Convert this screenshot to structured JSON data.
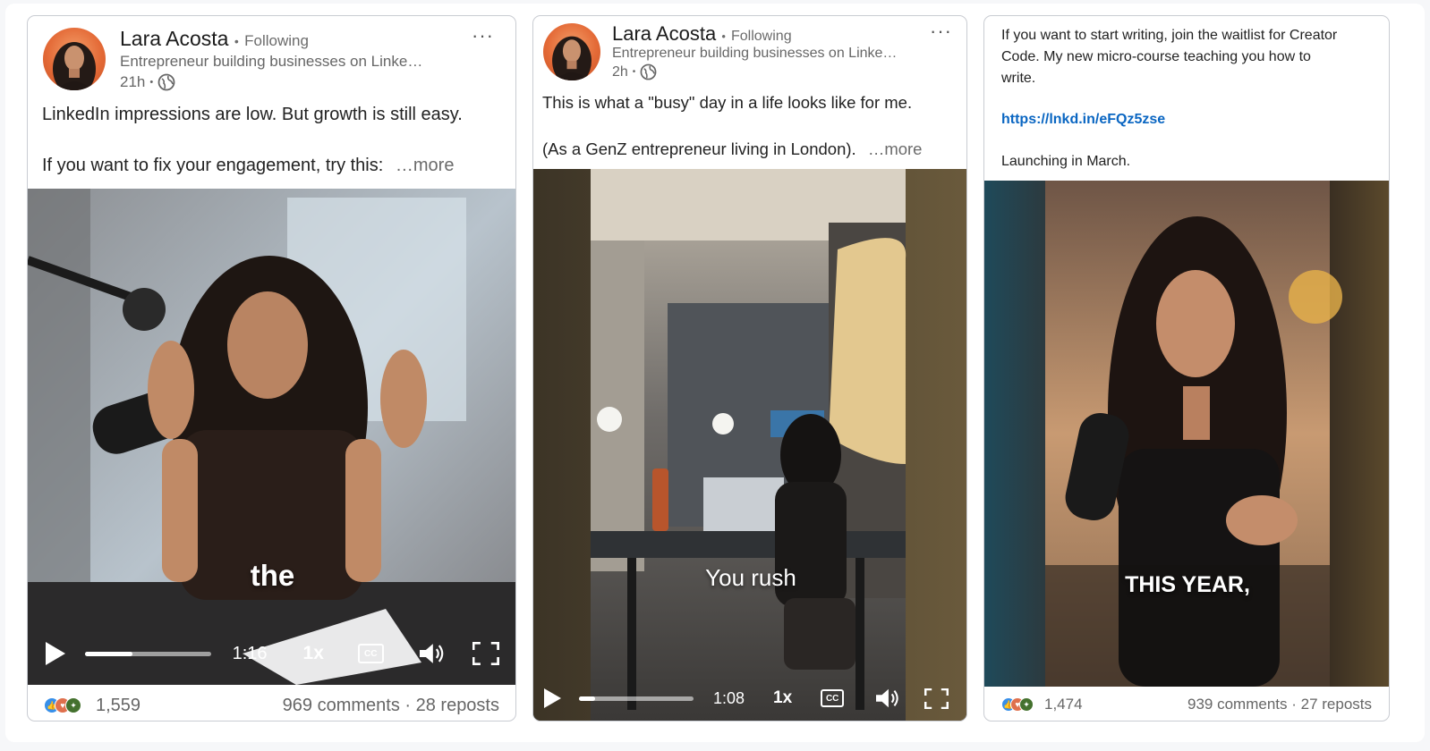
{
  "colors": {
    "link": "#0a66c2",
    "muted": "#666666",
    "avatar_bg": "#e46a37",
    "like": "#378fe9",
    "celebrate": "#44712e",
    "love": "#df704d",
    "insightful": "#f5bb5c"
  },
  "posts": [
    {
      "author": "Lara Acosta",
      "following": "Following",
      "dot": "•",
      "subtitle": "Entrepreneur building businesses on Linke…",
      "time": "21h",
      "menu": "···",
      "text_line1": "LinkedIn impressions are low. But growth is still easy.",
      "text_line2": "If you want to fix your engagement, try this:",
      "more": "…more",
      "caption": "the",
      "duration": "1:16",
      "speed": "1x",
      "cc": "CC",
      "progress": 0.38,
      "reactions_count": "1,559",
      "comments_reposts": "969 comments · 28 reposts",
      "reaction_icons": [
        "like-icon",
        "love-icon",
        "celebrate-icon"
      ]
    },
    {
      "author": "Lara Acosta",
      "following": "Following",
      "dot": "•",
      "subtitle": "Entrepreneur building businesses on Linke…",
      "time": "2h",
      "menu": "···",
      "text_line1": "This is what a \"busy\" day in a life looks like for me.",
      "text_line2": "(As a GenZ entrepreneur living in London).",
      "more": "…more",
      "caption": "You rush",
      "duration": "1:08",
      "speed": "1x",
      "cc": "CC",
      "progress": 0.14
    },
    {
      "text_line1": "If you want to start writing, join the waitlist for Creator",
      "text_line2": "Code. My new micro-course teaching you how to",
      "text_line3": "write.",
      "link": "https://lnkd.in/eFQz5zse",
      "text_line4": "Launching in March.",
      "caption": "THIS YEAR,",
      "reactions_count": "1,474",
      "comments_reposts": "939 comments · 27 reposts",
      "reaction_icons": [
        "like-icon",
        "love-icon",
        "insightful-icon"
      ]
    }
  ]
}
